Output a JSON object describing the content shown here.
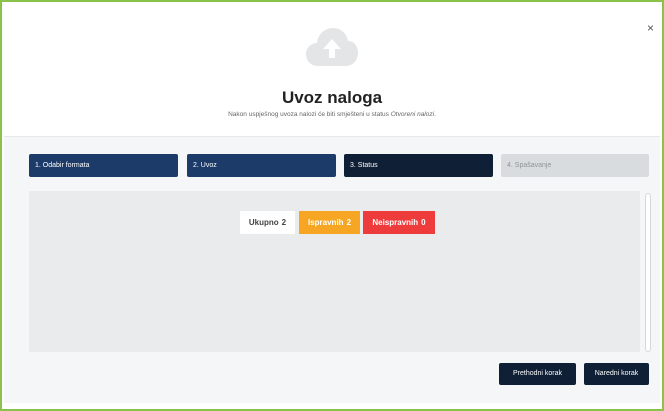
{
  "dialog": {
    "close_label": "×",
    "title": "Uvoz naloga",
    "subtitle_prefix": "Nakon uspješnog uvoza nalozi će biti smješteni u status ",
    "subtitle_status": "Otvoreni nalozi",
    "subtitle_suffix": "."
  },
  "steps": [
    {
      "label": "1. Odabir formata",
      "state": "completed"
    },
    {
      "label": "2. Uvoz",
      "state": "completed"
    },
    {
      "label": "3. Status",
      "state": "active"
    },
    {
      "label": "4. Spašavanje",
      "state": "disabled"
    }
  ],
  "counts": {
    "total_label": "Ukupno",
    "total_value": "2",
    "valid_label": "Ispravnih",
    "valid_value": "2",
    "invalid_label": "Neispravnih",
    "invalid_value": "0"
  },
  "buttons": {
    "previous": "Prethodni korak",
    "next": "Naredni korak"
  },
  "colors": {
    "frame": "#8bc34a",
    "step_done": "#1c3b68",
    "step_active": "#0f1f36",
    "valid": "#f6a623",
    "invalid": "#ee3b3b"
  },
  "icons": {
    "upload": "cloud-upload-icon"
  }
}
